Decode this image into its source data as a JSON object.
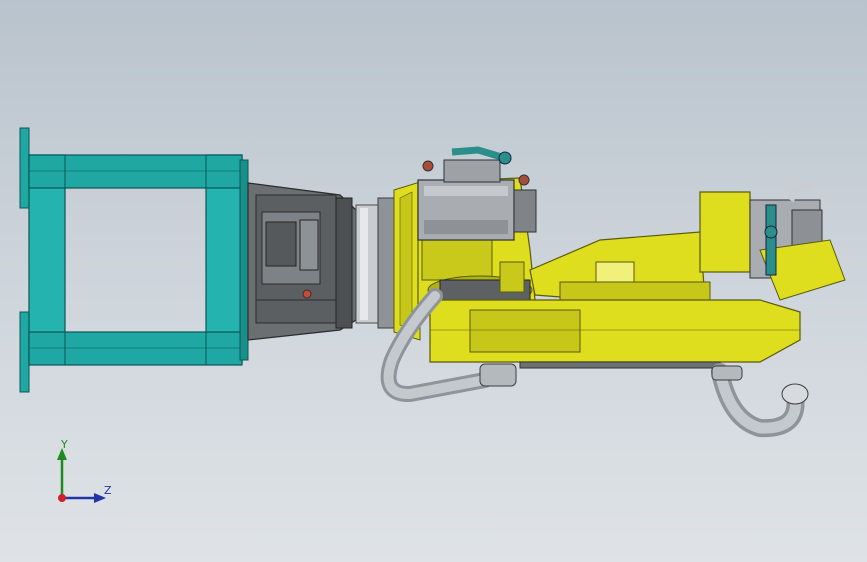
{
  "model_view": {
    "background_top": "#b9c3cd",
    "background_bottom": "#dfe3e7",
    "colors": {
      "frame": "#1fa7a3",
      "robot_body": "#dede1e",
      "gearbox": "#6b6f72",
      "motor": "#a9adb2",
      "hose": "#b9bec4",
      "fitting": "#2a8f8a"
    }
  },
  "triad": {
    "y_label": "Y",
    "z_label": "Z",
    "y_color": "#1f8a1f",
    "z_color": "#2433a8",
    "origin_color": "#d01f2a"
  }
}
